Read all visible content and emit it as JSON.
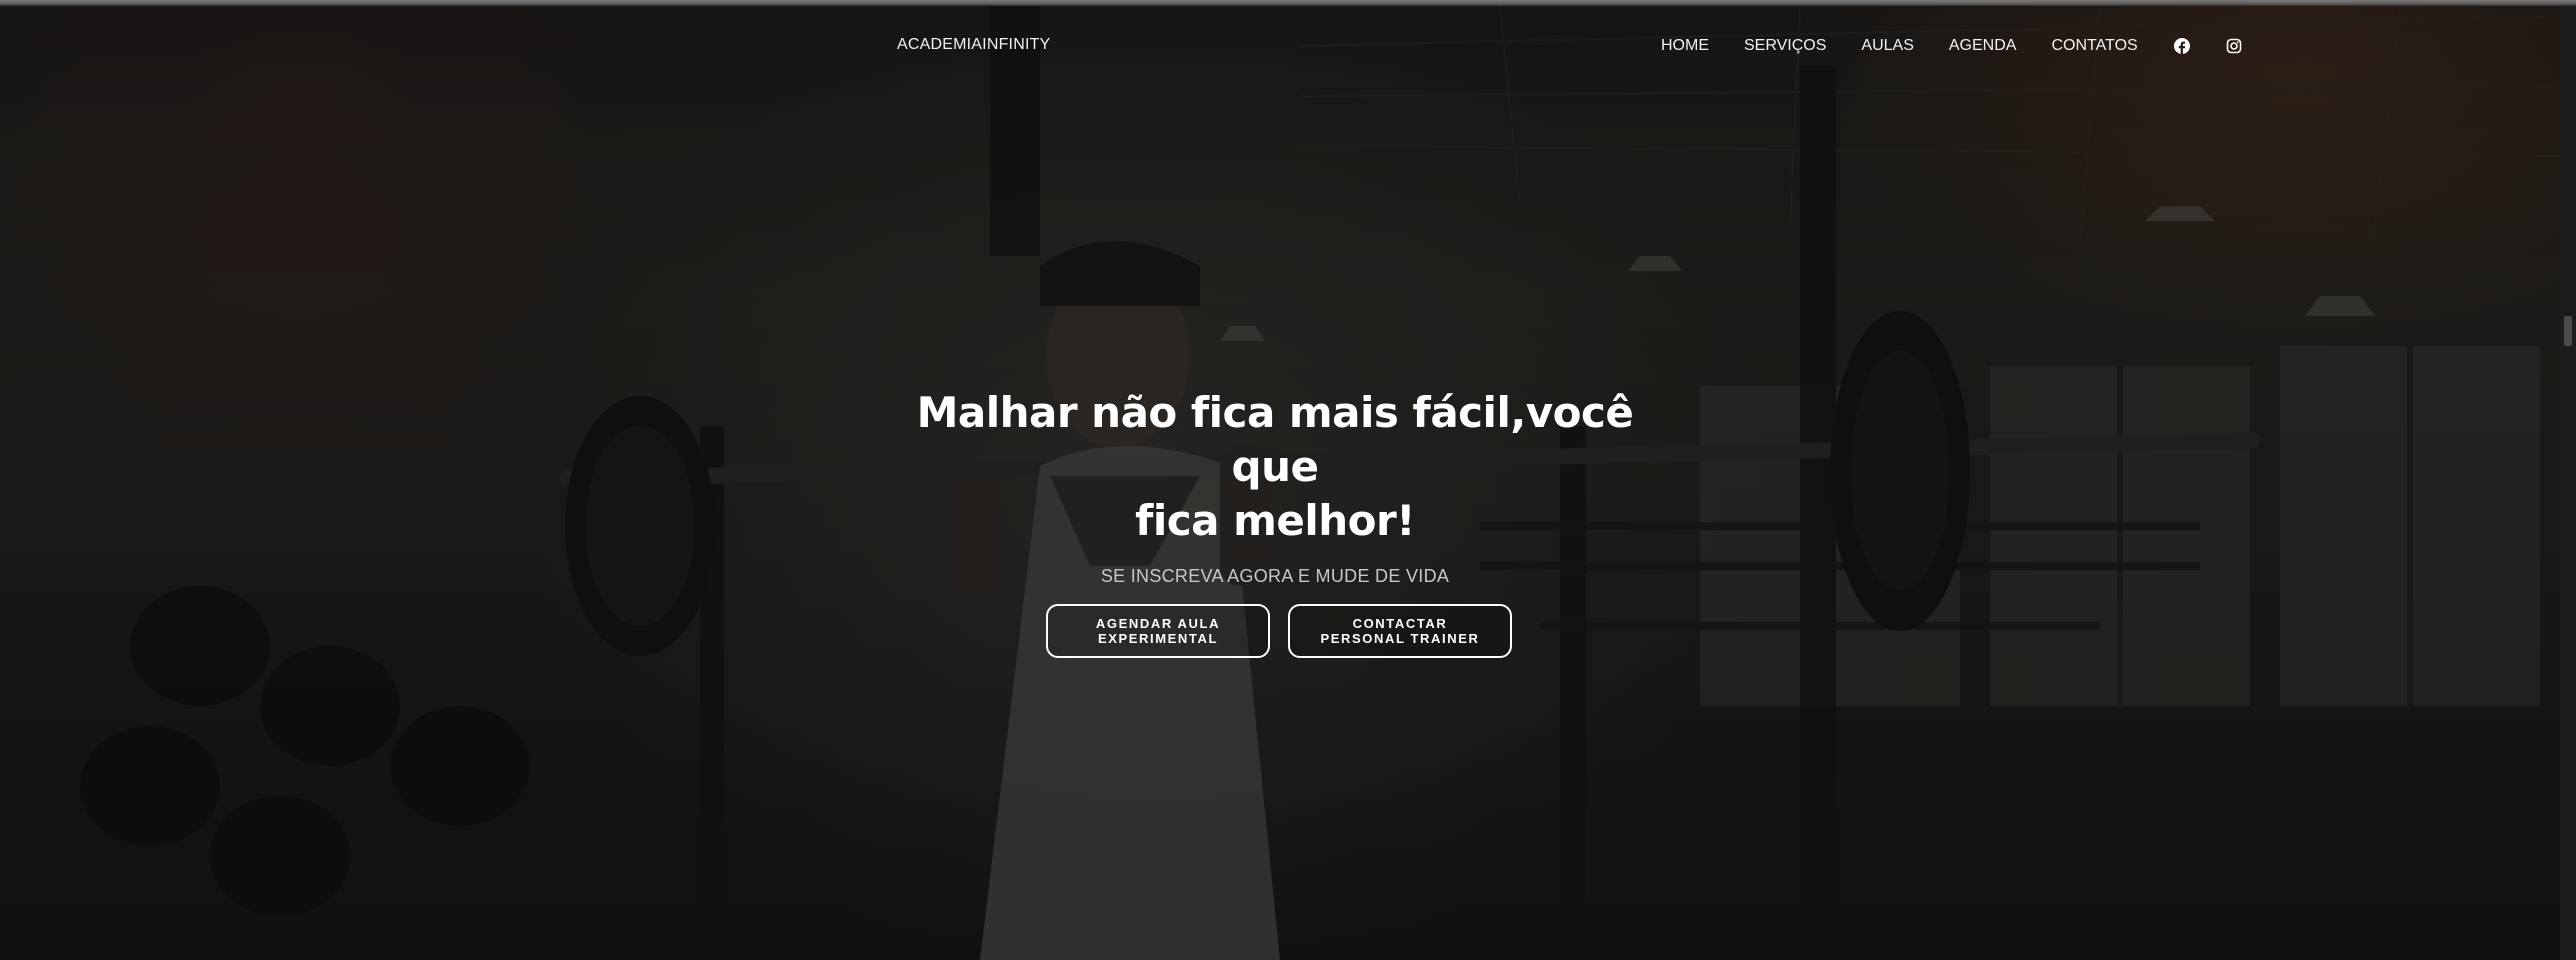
{
  "navbar": {
    "brand": "ACADEMIAINFINITY",
    "links": [
      {
        "label": "HOME"
      },
      {
        "label": "SERVIÇOS"
      },
      {
        "label": "AULAS"
      },
      {
        "label": "AGENDA"
      },
      {
        "label": "CONTATOS"
      }
    ],
    "social_icons": [
      "facebook-icon",
      "instagram-icon"
    ]
  },
  "hero": {
    "headline_line1": "Malhar não fica mais fácil,você que",
    "headline_line2": "fica melhor!",
    "subtitle": "SE INSCREVA AGORA E MUDE DE VIDA",
    "buttons": [
      {
        "label": "AGENDAR AULA EXPERIMENTAL"
      },
      {
        "label": "CONTACTAR PERSONAL TRAINER"
      }
    ]
  },
  "colors": {
    "text": "#ffffff",
    "subtitle": "#c8c8c8",
    "background": "#1e1c1a"
  }
}
